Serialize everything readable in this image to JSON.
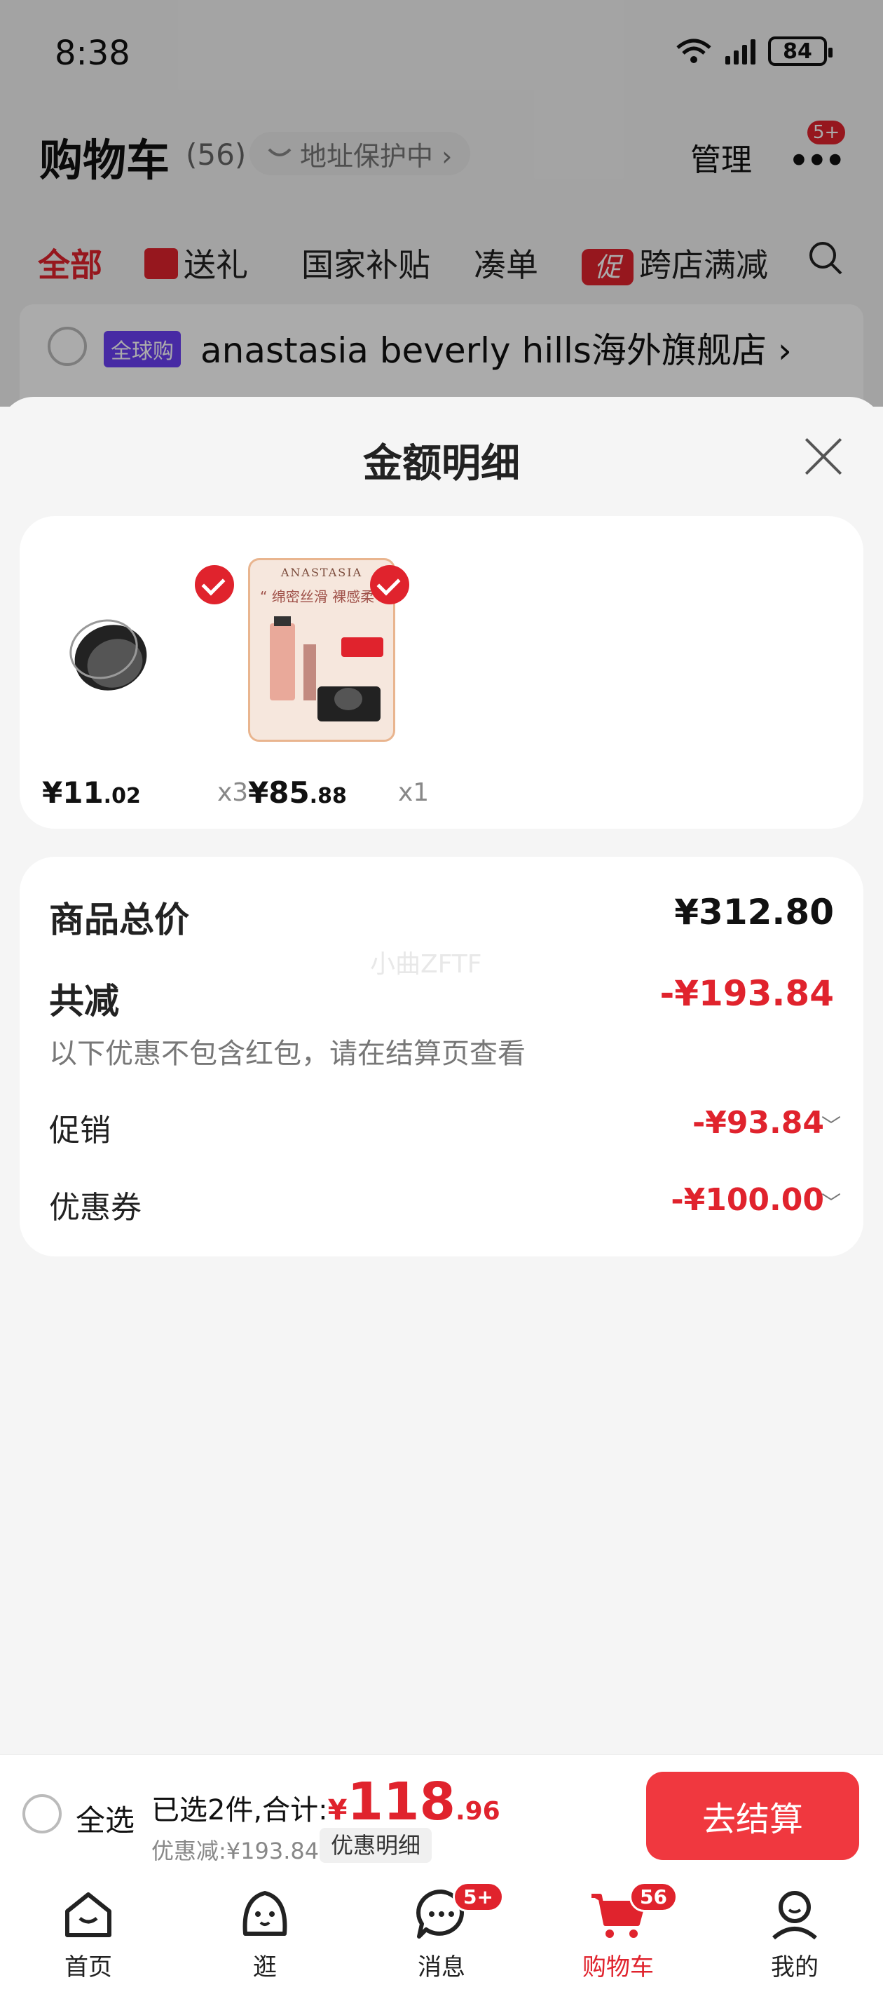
{
  "status_bar": {
    "time": "8:38",
    "battery": "84"
  },
  "header": {
    "title": "购物车",
    "count": "(56)",
    "address_label": "地址保护中 ›",
    "manage_label": "管理",
    "more_badge": "5+"
  },
  "tabs": [
    {
      "label": "全部"
    },
    {
      "label": "送礼"
    },
    {
      "label": "国家补贴"
    },
    {
      "label": "凑单"
    },
    {
      "label": "跨店满减",
      "icon_text": "促"
    }
  ],
  "store": {
    "tag": "全球购",
    "name": "anastasia beverly hills海外旗舰店 ›"
  },
  "sheet": {
    "title": "金额明细",
    "products": [
      {
        "price_int": "¥11",
        "price_dec": ".02",
        "qty": "x3",
        "image_icon": "compact-mirror"
      },
      {
        "price_int": "¥85",
        "price_dec": ".88",
        "qty": "x1",
        "image_icon": "cosmetics-kit",
        "image_text_brand": "ANASTASIA",
        "image_text_slogan": "“ 绵密丝滑 裸感柔"
      }
    ],
    "summary": {
      "total_label": "商品总价",
      "total_value": "¥312.80",
      "reduce_label": "共减",
      "reduce_value": "-¥193.84",
      "note": "以下优惠不包含红包，请在结算页查看",
      "promo_label": "促销",
      "promo_value": "-¥93.84",
      "coupon_label": "优惠券",
      "coupon_value": "-¥100.00",
      "watermark": "小曲ZFTF"
    }
  },
  "checkout": {
    "select_all": "全选",
    "selected_prefix": "已选2件,合计:",
    "yen": "¥",
    "total_int": "118",
    "total_dec": ".96",
    "discount": "优惠减:¥193.84",
    "detail_button": "优惠明细",
    "checkout_button": "去结算"
  },
  "tabbar": [
    {
      "label": "首页",
      "icon": "home-icon"
    },
    {
      "label": "逛",
      "icon": "stroll-icon"
    },
    {
      "label": "消息",
      "icon": "message-icon",
      "badge": "5+"
    },
    {
      "label": "购物车",
      "icon": "cart-icon",
      "badge": "56"
    },
    {
      "label": "我的",
      "icon": "profile-icon"
    }
  ],
  "colors": {
    "accent": "#e0232d",
    "button": "#f0383f",
    "sheet_bg": "#f5f5f5"
  }
}
